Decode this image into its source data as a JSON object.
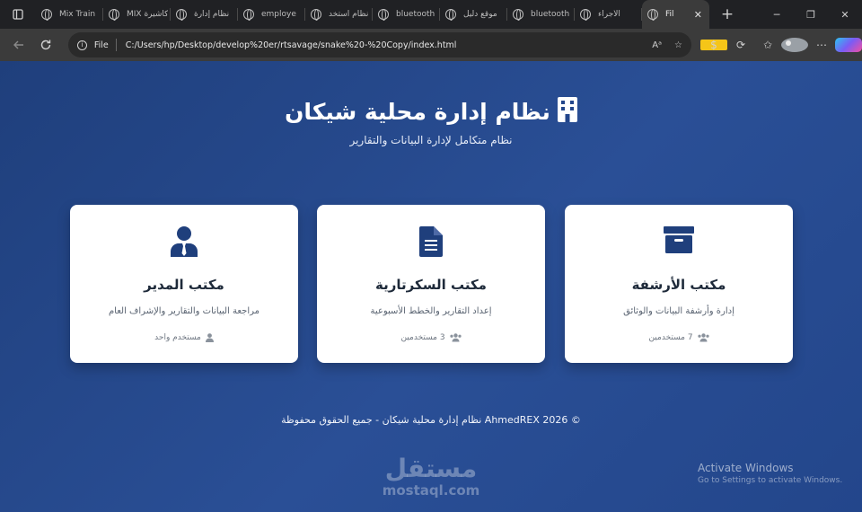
{
  "browser": {
    "tabs": [
      {
        "title": "Mix Train",
        "active": false
      },
      {
        "title": "MIX كاشيرة",
        "active": false
      },
      {
        "title": "نظام إدارة",
        "active": false
      },
      {
        "title": "employe",
        "active": false
      },
      {
        "title": "نظام استخد",
        "active": false
      },
      {
        "title": "bluetooth",
        "active": false
      },
      {
        "title": "موقع دليل",
        "active": false
      },
      {
        "title": "bluetooth",
        "active": false
      },
      {
        "title": "الأجراء",
        "active": false
      },
      {
        "title": "Fil",
        "active": true
      }
    ],
    "new_tab_label": "+",
    "address": {
      "scheme_label": "File",
      "url": "C:/Users/hp/Desktop/develop%20er/rtsavage/snake%20-%20Copy/index.html"
    }
  },
  "page": {
    "title": "نظام إدارة محلية شيكان",
    "subtitle": "نظام متكامل لإدارة البيانات والتقارير",
    "cards": [
      {
        "icon": "archive-icon",
        "title": "مكتب الأرشفة",
        "description": "إدارة وأرشفة البيانات والوثائق",
        "users": "7 مستخدمين",
        "users_icon": "users-icon"
      },
      {
        "icon": "document-icon",
        "title": "مكتب السكرتارية",
        "description": "إعداد التقارير والخطط الأسبوعية",
        "users": "3 مستخدمين",
        "users_icon": "users-icon"
      },
      {
        "icon": "manager-icon",
        "title": "مكتب المدير",
        "description": "مراجعة البيانات والتقارير والإشراف العام",
        "users": "مستخدم واحد",
        "users_icon": "user-icon"
      }
    ],
    "footer": "© 2026 AhmedREX نظام إدارة محلية شيكان - جميع الحقوق محفوظة"
  },
  "watermark": {
    "arabic": "مستقل",
    "latin": "mostaql.com"
  },
  "os_notice": {
    "line1": "Activate Windows",
    "line2": "Go to Settings to activate Windows."
  },
  "colors": {
    "page_bg": "#23468b",
    "card_bg": "#ffffff",
    "icon_navy": "#1f3f7c"
  }
}
